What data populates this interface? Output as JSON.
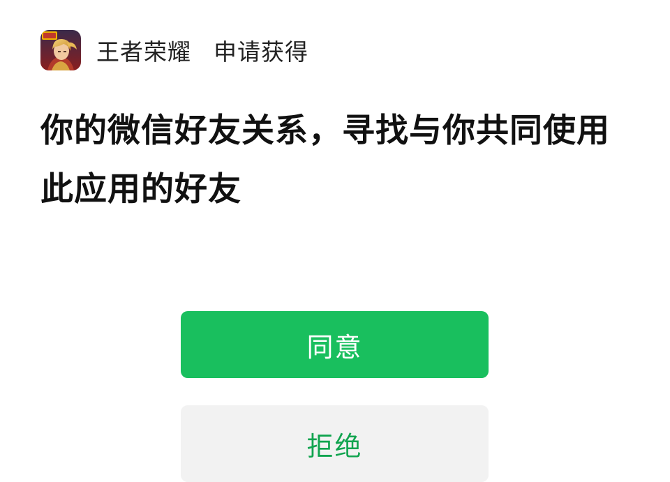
{
  "header": {
    "app_icon": "honor-of-kings-app-icon",
    "app_name": "王者荣耀",
    "request_label": "申请获得"
  },
  "permission": {
    "description": "你的微信好友关系，寻找与你共同使用此应用的好友"
  },
  "buttons": {
    "agree_label": "同意",
    "reject_label": "拒绝"
  },
  "colors": {
    "primary_green": "#19bf5e",
    "reject_text_green": "#11a44f",
    "reject_bg": "#f2f2f2"
  }
}
